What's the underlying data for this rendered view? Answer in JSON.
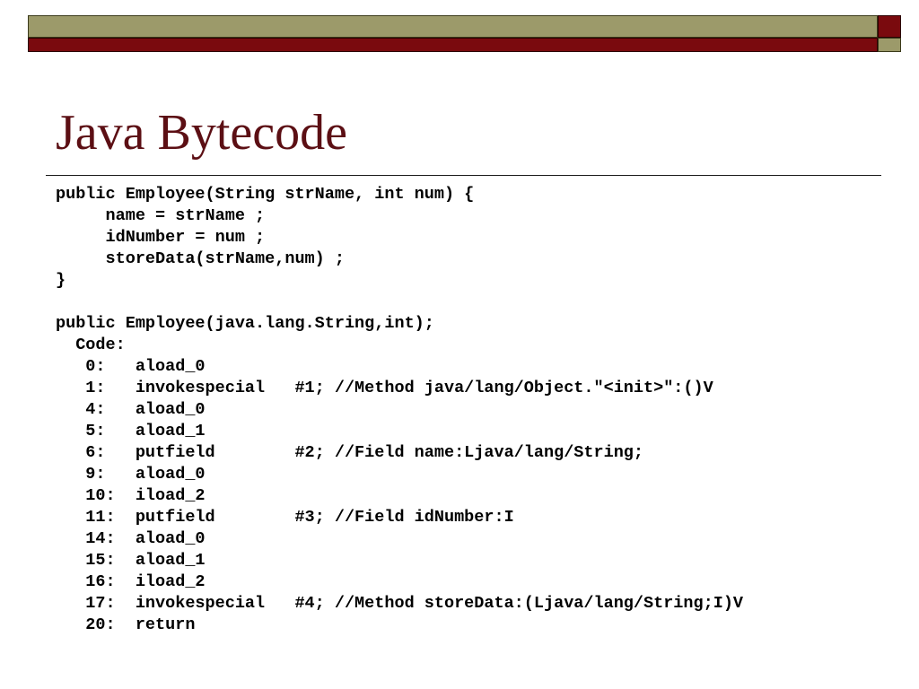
{
  "slide": {
    "title": "Java Bytecode",
    "code_lines": [
      "public Employee(String strName, int num) {",
      "     name = strName ;",
      "     idNumber = num ;",
      "     storeData(strName,num) ;",
      "}",
      "",
      "public Employee(java.lang.String,int);",
      "  Code:",
      "   0:   aload_0",
      "   1:   invokespecial   #1; //Method java/lang/Object.\"<init>\":()V",
      "   4:   aload_0",
      "   5:   aload_1",
      "   6:   putfield        #2; //Field name:Ljava/lang/String;",
      "   9:   aload_0",
      "   10:  iload_2",
      "   11:  putfield        #3; //Field idNumber:I",
      "   14:  aload_0",
      "   15:  aload_1",
      "   16:  iload_2",
      "   17:  invokespecial   #4; //Method storeData:(Ljava/lang/String;I)V",
      "   20:  return"
    ]
  },
  "theme": {
    "title_color": "#5c0f14",
    "olive": "#9c9a6a",
    "maroon": "#7a0a0e"
  }
}
